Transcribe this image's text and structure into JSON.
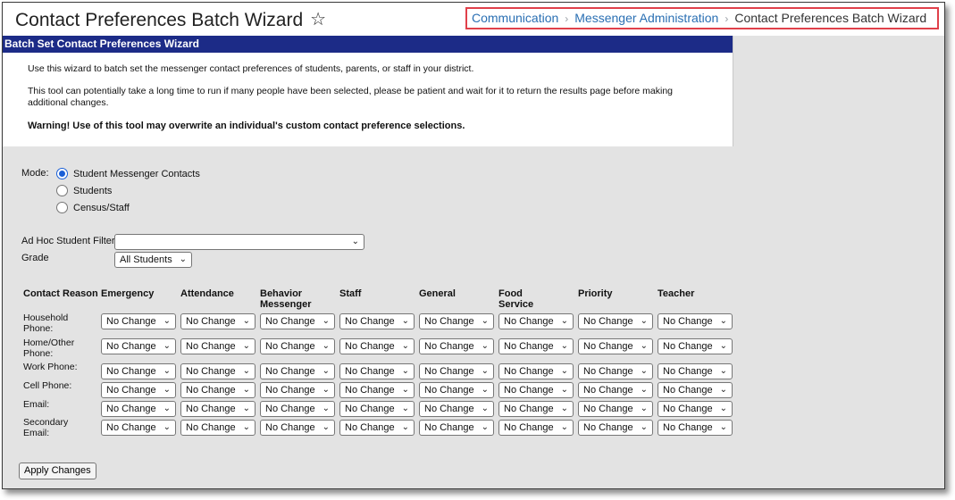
{
  "header": {
    "title": "Contact Preferences Batch Wizard",
    "favorite_icon": "star-outline-icon",
    "breadcrumb": {
      "item1": "Communication",
      "item2": "Messenger Administration",
      "current": "Contact Preferences Batch Wizard",
      "separator": "›"
    }
  },
  "panel": {
    "title": "Batch Set Contact Preferences Wizard",
    "intro": "Use this wizard to batch set the messenger contact preferences of students, parents, or staff in your district.",
    "note": "This tool can potentially take a long time to run if many people have been selected, please be patient and wait for it to return the results page before making additional changes.",
    "warning": "Warning! Use of this tool may overwrite an individual's custom contact preference selections."
  },
  "form": {
    "mode_label": "Mode:",
    "modes": [
      "Student Messenger Contacts",
      "Students",
      "Census/Staff"
    ],
    "selected_mode": "Student Messenger Contacts",
    "adhoc_label": "Ad Hoc Student Filter",
    "adhoc_value": "",
    "grade_label": "Grade",
    "grade_value": "All Students"
  },
  "matrix": {
    "corner": "Contact Reason",
    "columns": [
      "Emergency",
      "Attendance",
      "Behavior Messenger",
      "Staff",
      "General",
      "Food Service",
      "Priority",
      "Teacher"
    ],
    "rows": [
      "Household Phone:",
      "Home/Other Phone:",
      "Work Phone:",
      "Cell Phone:",
      "Email:",
      "Secondary Email:"
    ],
    "cell_value": "No Change"
  },
  "actions": {
    "apply": "Apply Changes"
  },
  "colors": {
    "panel_header": "#1c2b87",
    "link": "#2a6fb3",
    "highlight": "#e0404a"
  }
}
